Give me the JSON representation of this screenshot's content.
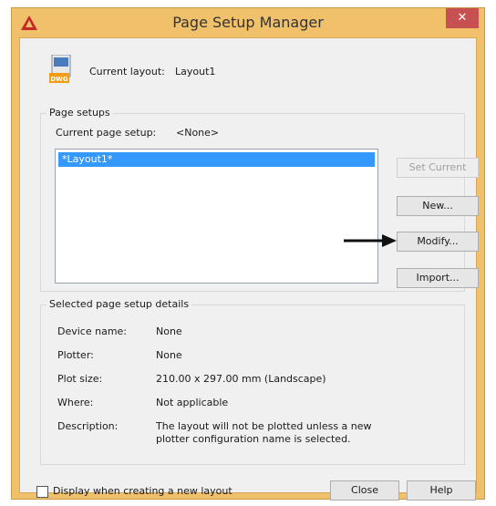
{
  "window": {
    "title": "Page Setup Manager",
    "close_glyph": "✕",
    "app_icon": "autocad-icon"
  },
  "header": {
    "icon": "dwg-file-icon",
    "icon_text": "DWG",
    "current_layout_label": "Current layout:",
    "current_layout_value": "Layout1"
  },
  "page_setups": {
    "group_title": "Page setups",
    "current_label": "Current page setup:",
    "current_value": "<None>",
    "items": [
      "*Layout1*"
    ],
    "buttons": {
      "set_current": "Set Current",
      "new": "New...",
      "modify": "Modify...",
      "import": "Import..."
    }
  },
  "details": {
    "group_title": "Selected page setup details",
    "rows": [
      {
        "label": "Device name:",
        "value": "None"
      },
      {
        "label": "Plotter:",
        "value": "None"
      },
      {
        "label": "Plot size:",
        "value": "210.00 x 297.00 mm (Landscape)"
      },
      {
        "label": "Where:",
        "value": "Not applicable"
      },
      {
        "label": "Description:",
        "value": "The layout will not be plotted unless a new plotter configuration name is selected."
      }
    ]
  },
  "footer": {
    "checkbox_label": "Display when creating a new layout",
    "checkbox_checked": false,
    "close": "Close",
    "help": "Help"
  },
  "annotation": {
    "arrow": "right-arrow-icon"
  },
  "colors": {
    "title_bar": "#f0c06a",
    "selection": "#3399ff",
    "close_button": "#c75050"
  }
}
